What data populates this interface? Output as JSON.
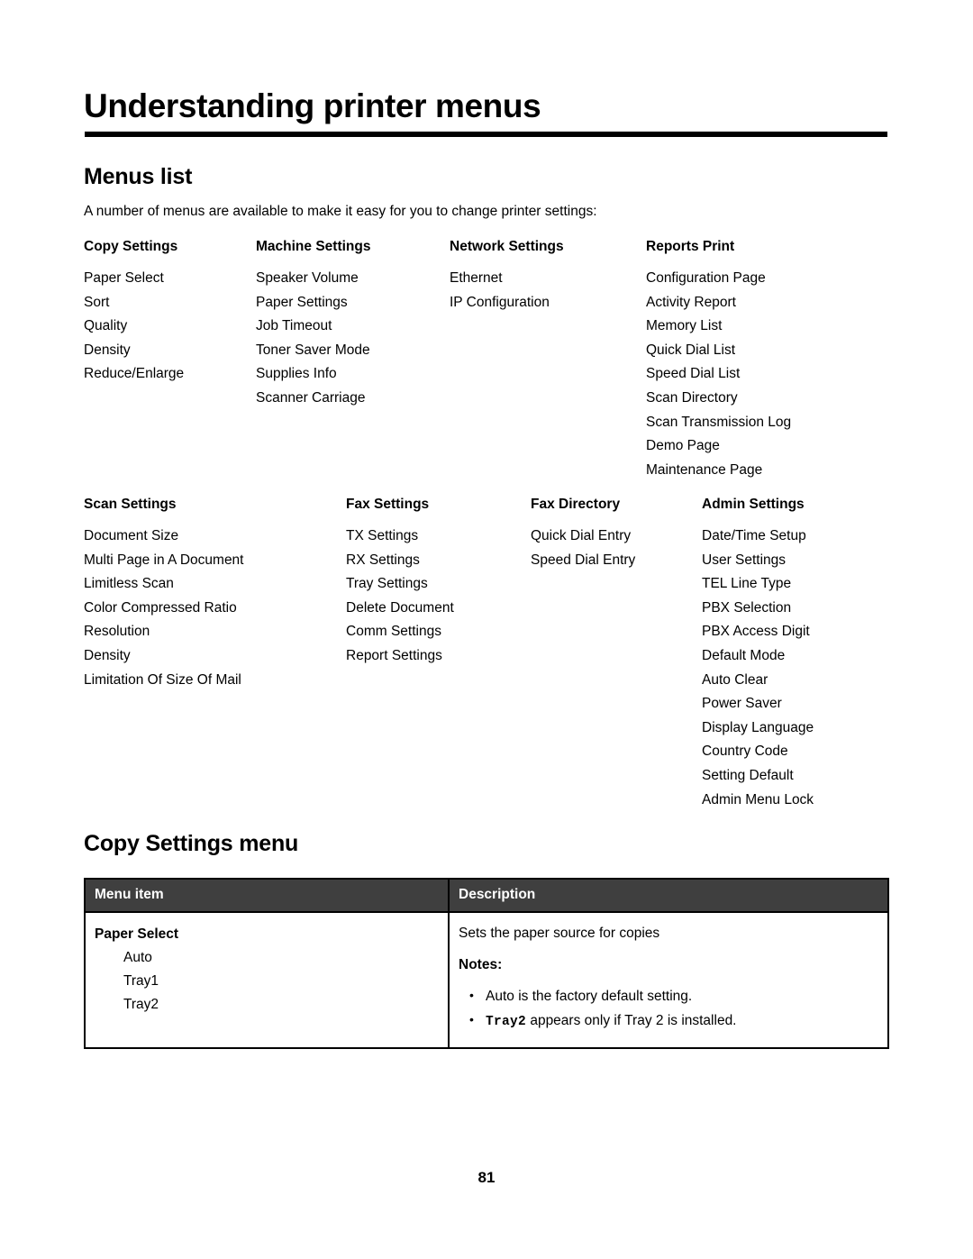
{
  "document": {
    "title": "Understanding printer menus",
    "page_number": "81"
  },
  "menus_list": {
    "heading": "Menus list",
    "intro": "A number of menus are available to make it easy for you to change printer settings:",
    "blocks": [
      {
        "columns": [
          {
            "header": "Copy Settings",
            "items": [
              "Paper Select",
              "Sort",
              "Quality",
              "Density",
              "Reduce/Enlarge"
            ]
          },
          {
            "header": "Machine Settings",
            "items": [
              "Speaker Volume",
              "Paper Settings",
              "Job Timeout",
              "Toner Saver Mode",
              "Supplies Info",
              "Scanner Carriage"
            ]
          },
          {
            "header": "Network Settings",
            "items": [
              "Ethernet",
              "IP Configuration"
            ]
          },
          {
            "header": "Reports Print",
            "items": [
              "Configuration Page",
              "Activity Report",
              "Memory List",
              "Quick Dial List",
              "Speed Dial List",
              "Scan Directory",
              "Scan Transmission Log",
              "Demo Page",
              "Maintenance Page"
            ]
          }
        ]
      },
      {
        "columns": [
          {
            "header": "Scan Settings",
            "items": [
              "Document Size",
              "Multi Page in A Document",
              "Limitless Scan",
              "Color Compressed Ratio",
              "Resolution",
              "Density",
              "Limitation Of Size Of Mail"
            ]
          },
          {
            "header": "Fax Settings",
            "items": [
              "TX Settings",
              "RX Settings",
              "Tray Settings",
              "Delete Document",
              "Comm Settings",
              "Report Settings"
            ]
          },
          {
            "header": "Fax Directory",
            "items": [
              "Quick Dial Entry",
              "Speed Dial Entry"
            ]
          },
          {
            "header": "Admin Settings",
            "items": [
              "Date/Time Setup",
              "User Settings",
              "TEL Line Type",
              "PBX Selection",
              "PBX Access Digit",
              "Default Mode",
              "Auto Clear",
              "Power Saver",
              "Display Language",
              "Country Code",
              "Setting Default",
              "Admin Menu Lock"
            ]
          }
        ]
      }
    ]
  },
  "copy_settings_menu": {
    "heading": "Copy Settings menu",
    "table": {
      "headers": {
        "menu_item": "Menu item",
        "description": "Description"
      },
      "header_background": "#3f3f3f",
      "rows": [
        {
          "menu_item_title": "Paper Select",
          "menu_item_options": [
            "Auto",
            "Tray1",
            "Tray2"
          ],
          "description_line": "Sets the paper source for copies",
          "notes_label": "Notes:",
          "notes": [
            {
              "parts": [
                {
                  "text": "Auto is the factory default setting.",
                  "style": "normal"
                }
              ]
            },
            {
              "parts": [
                {
                  "text": "Tray2",
                  "style": "mono-bold"
                },
                {
                  "text": " appears only if Tray 2 is installed.",
                  "style": "normal"
                }
              ]
            }
          ]
        }
      ]
    }
  }
}
